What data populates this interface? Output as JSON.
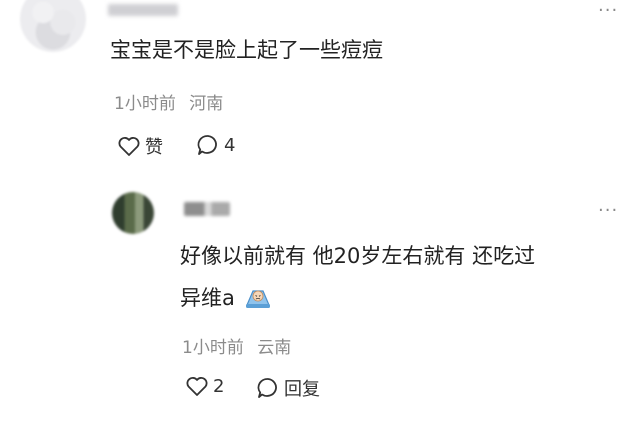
{
  "comment": {
    "text": "宝宝是不是脸上起了一些痘痘",
    "time": "1小时前",
    "location": "河南",
    "like_label": "赞",
    "reply_count": "4"
  },
  "reply": {
    "text_line1": "好像以前就有 他20岁左右就有 还吃过",
    "text_line2": "异维a",
    "time": "1小时前",
    "location": "云南",
    "like_count": "2",
    "reply_label": "回复"
  },
  "icons": {
    "more": "more-dots-icon",
    "like": "heart-outline-icon",
    "comment": "chat-bubble-icon",
    "sticker": "crying-face-sticker-icon"
  },
  "colors": {
    "text": "#222222",
    "meta": "#8b8b8b",
    "background": "#ffffff"
  }
}
